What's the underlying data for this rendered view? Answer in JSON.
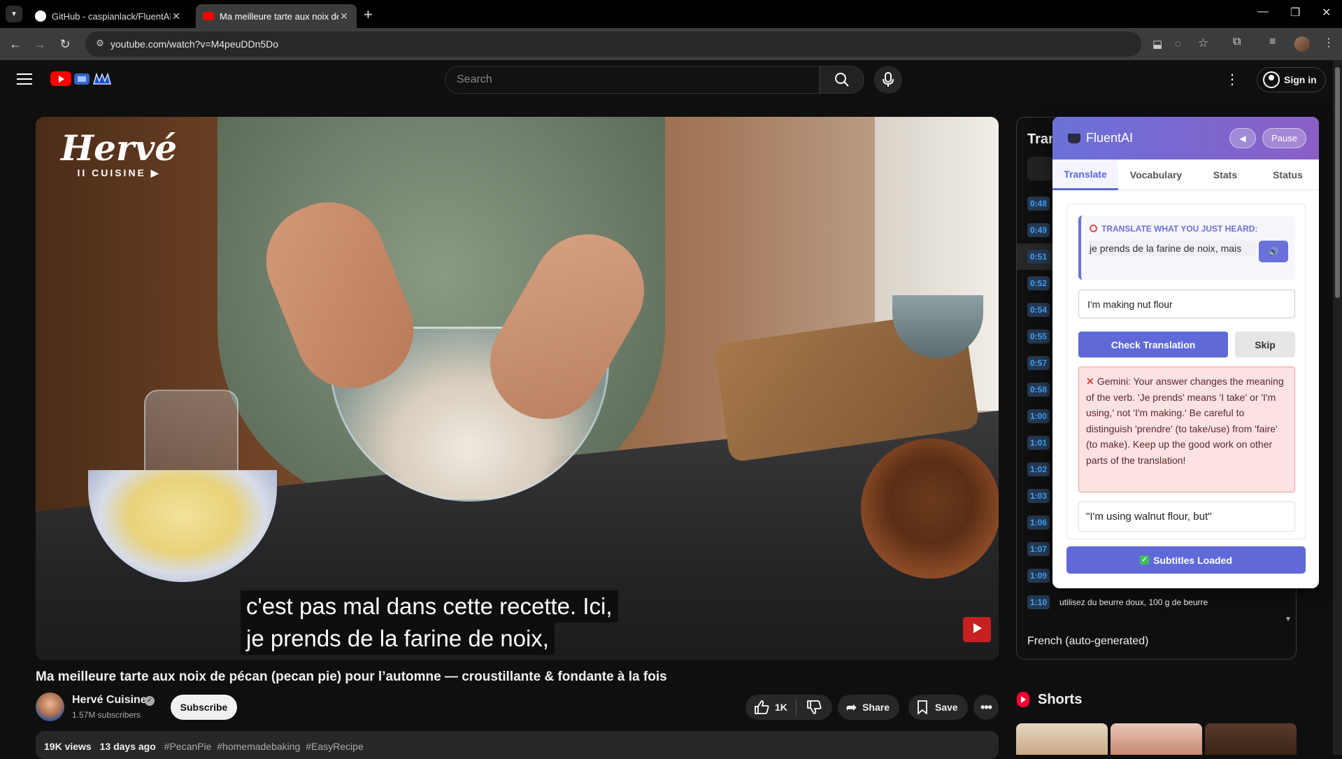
{
  "browser": {
    "tabs": [
      {
        "title": "GitHub - caspianlack/FluentAI: ",
        "active": false
      },
      {
        "title": "Ma meilleure tarte aux noix de ",
        "active": true
      }
    ],
    "new_tab": "+",
    "url": "youtube.com/watch?v=M4peuDDn5Do"
  },
  "youtube": {
    "search_placeholder": "Search",
    "sign_in": "Sign in",
    "video": {
      "logo_line1": "Hervé",
      "logo_line2": "II CUISINE ▶",
      "caption_line1": "c'est pas mal dans cette recette. Ici,",
      "caption_line2": "je prends de la farine de noix,",
      "title": "Ma meilleure tarte aux noix de pécan (pecan pie) pour l’automne — croustillante & fondante à la fois"
    },
    "channel": {
      "name": "Hervé Cuisine",
      "subscribers": "1.57M subscribers",
      "subscribe_label": "Subscribe"
    },
    "actions": {
      "likes": "1K",
      "share": "Share",
      "save": "Save"
    },
    "description": {
      "views": "19K views",
      "age": "13 days ago",
      "hashtags": [
        "#PecanPie",
        "#homemadebaking",
        "#EasyRecipe"
      ]
    },
    "transcript": {
      "title": "Tran",
      "language": "French (auto-generated)",
      "rows": [
        {
          "time": "0:48",
          "text": ""
        },
        {
          "time": "0:49",
          "text": ""
        },
        {
          "time": "0:51",
          "text": ""
        },
        {
          "time": "0:52",
          "text": ""
        },
        {
          "time": "0:54",
          "text": ""
        },
        {
          "time": "0:55",
          "text": ""
        },
        {
          "time": "0:57",
          "text": ""
        },
        {
          "time": "0:58",
          "text": ""
        },
        {
          "time": "1:00",
          "text": ""
        },
        {
          "time": "1:01",
          "text": ""
        },
        {
          "time": "1:02",
          "text": ""
        },
        {
          "time": "1:03",
          "text": ""
        },
        {
          "time": "1:06",
          "text": ""
        },
        {
          "time": "1:07",
          "text": ""
        },
        {
          "time": "1:09",
          "text": ""
        },
        {
          "time": "1:10",
          "text": "utilisez du beurre doux, 100 g de beurre"
        }
      ]
    },
    "shorts_label": "Shorts"
  },
  "fluentai": {
    "brand": "FluentAI",
    "pause": "Pause",
    "tabs": [
      "Translate",
      "Vocabulary",
      "Stats",
      "Status"
    ],
    "prompt_label": "TRANSLATE WHAT YOU JUST HEARD:",
    "heard_text": "je prends de la farine de noix, mais",
    "user_input": "I'm making nut flour",
    "check_label": "Check Translation",
    "skip_label": "Skip",
    "feedback": "Gemini: Your answer changes the meaning of the verb. 'Je prends' means 'I take' or 'I'm using,' not 'I'm making.' Be careful to distinguish 'prendre' (to take/use) from 'faire' (to make). Keep up the good work on other parts of the translation!",
    "correct_answer": "\"I'm using walnut flour, but\"",
    "status": "Subtitles Loaded",
    "accent_color": "#5f6ad8",
    "error_color": "#d94040"
  }
}
